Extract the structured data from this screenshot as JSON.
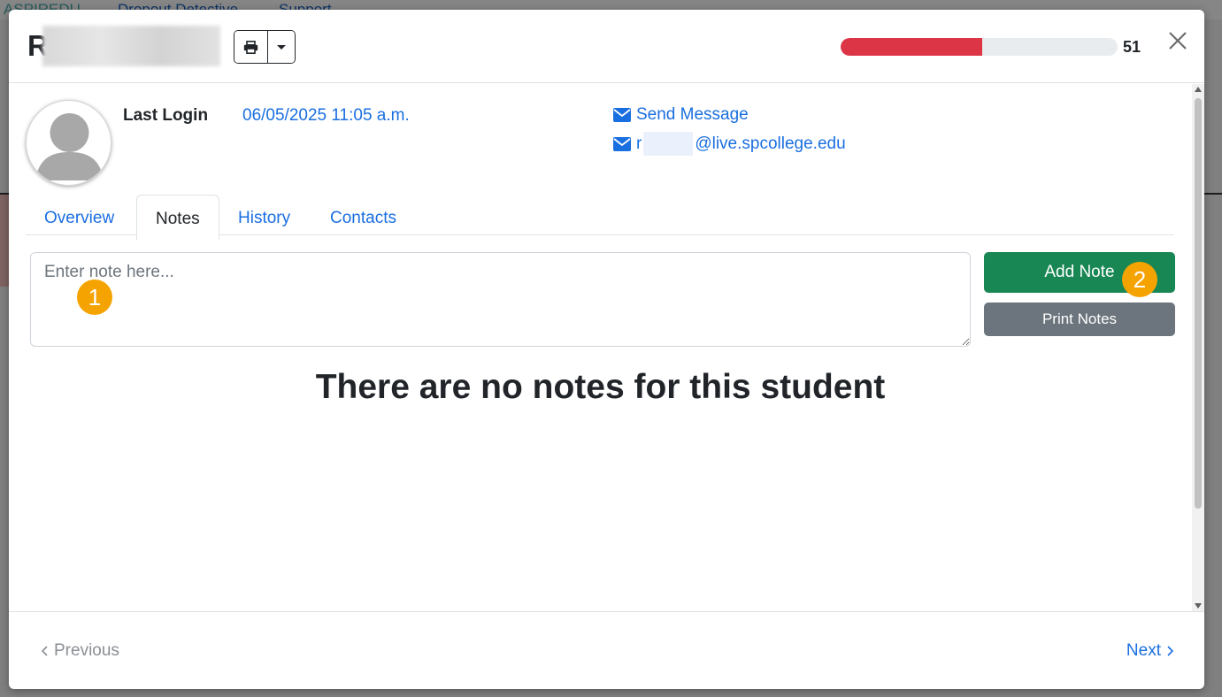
{
  "background": {
    "brand": "ASPIREDU",
    "nav_links": [
      "Dropout Detective",
      "Support"
    ]
  },
  "header": {
    "title_initial": "R",
    "print_icon": "printer-icon",
    "dropdown_icon": "caret-down-icon",
    "risk_score": "51",
    "risk_progress": 0.51,
    "risk_color": "#dc3545",
    "close_icon": "close-icon"
  },
  "profile": {
    "avatar_icon": "user-avatar-icon",
    "last_login_label": "Last Login",
    "last_login_value": "06/05/2025 11:05 a.m.",
    "send_message_label": "Send Message",
    "email_prefix": "r",
    "email_domain": "@live.spcollege.edu",
    "envelope_icon": "envelope-icon"
  },
  "tabs": [
    {
      "label": "Overview",
      "active": false
    },
    {
      "label": "Notes",
      "active": true
    },
    {
      "label": "History",
      "active": false
    },
    {
      "label": "Contacts",
      "active": false
    }
  ],
  "notes": {
    "placeholder": "Enter note here...",
    "add_button": "Add Note",
    "print_button": "Print Notes",
    "empty_message": "There are no notes for this student",
    "add_color": "#198754",
    "print_color": "#6c757d"
  },
  "callouts": [
    "1",
    "2"
  ],
  "footer": {
    "previous_label": "Previous",
    "next_label": "Next"
  }
}
